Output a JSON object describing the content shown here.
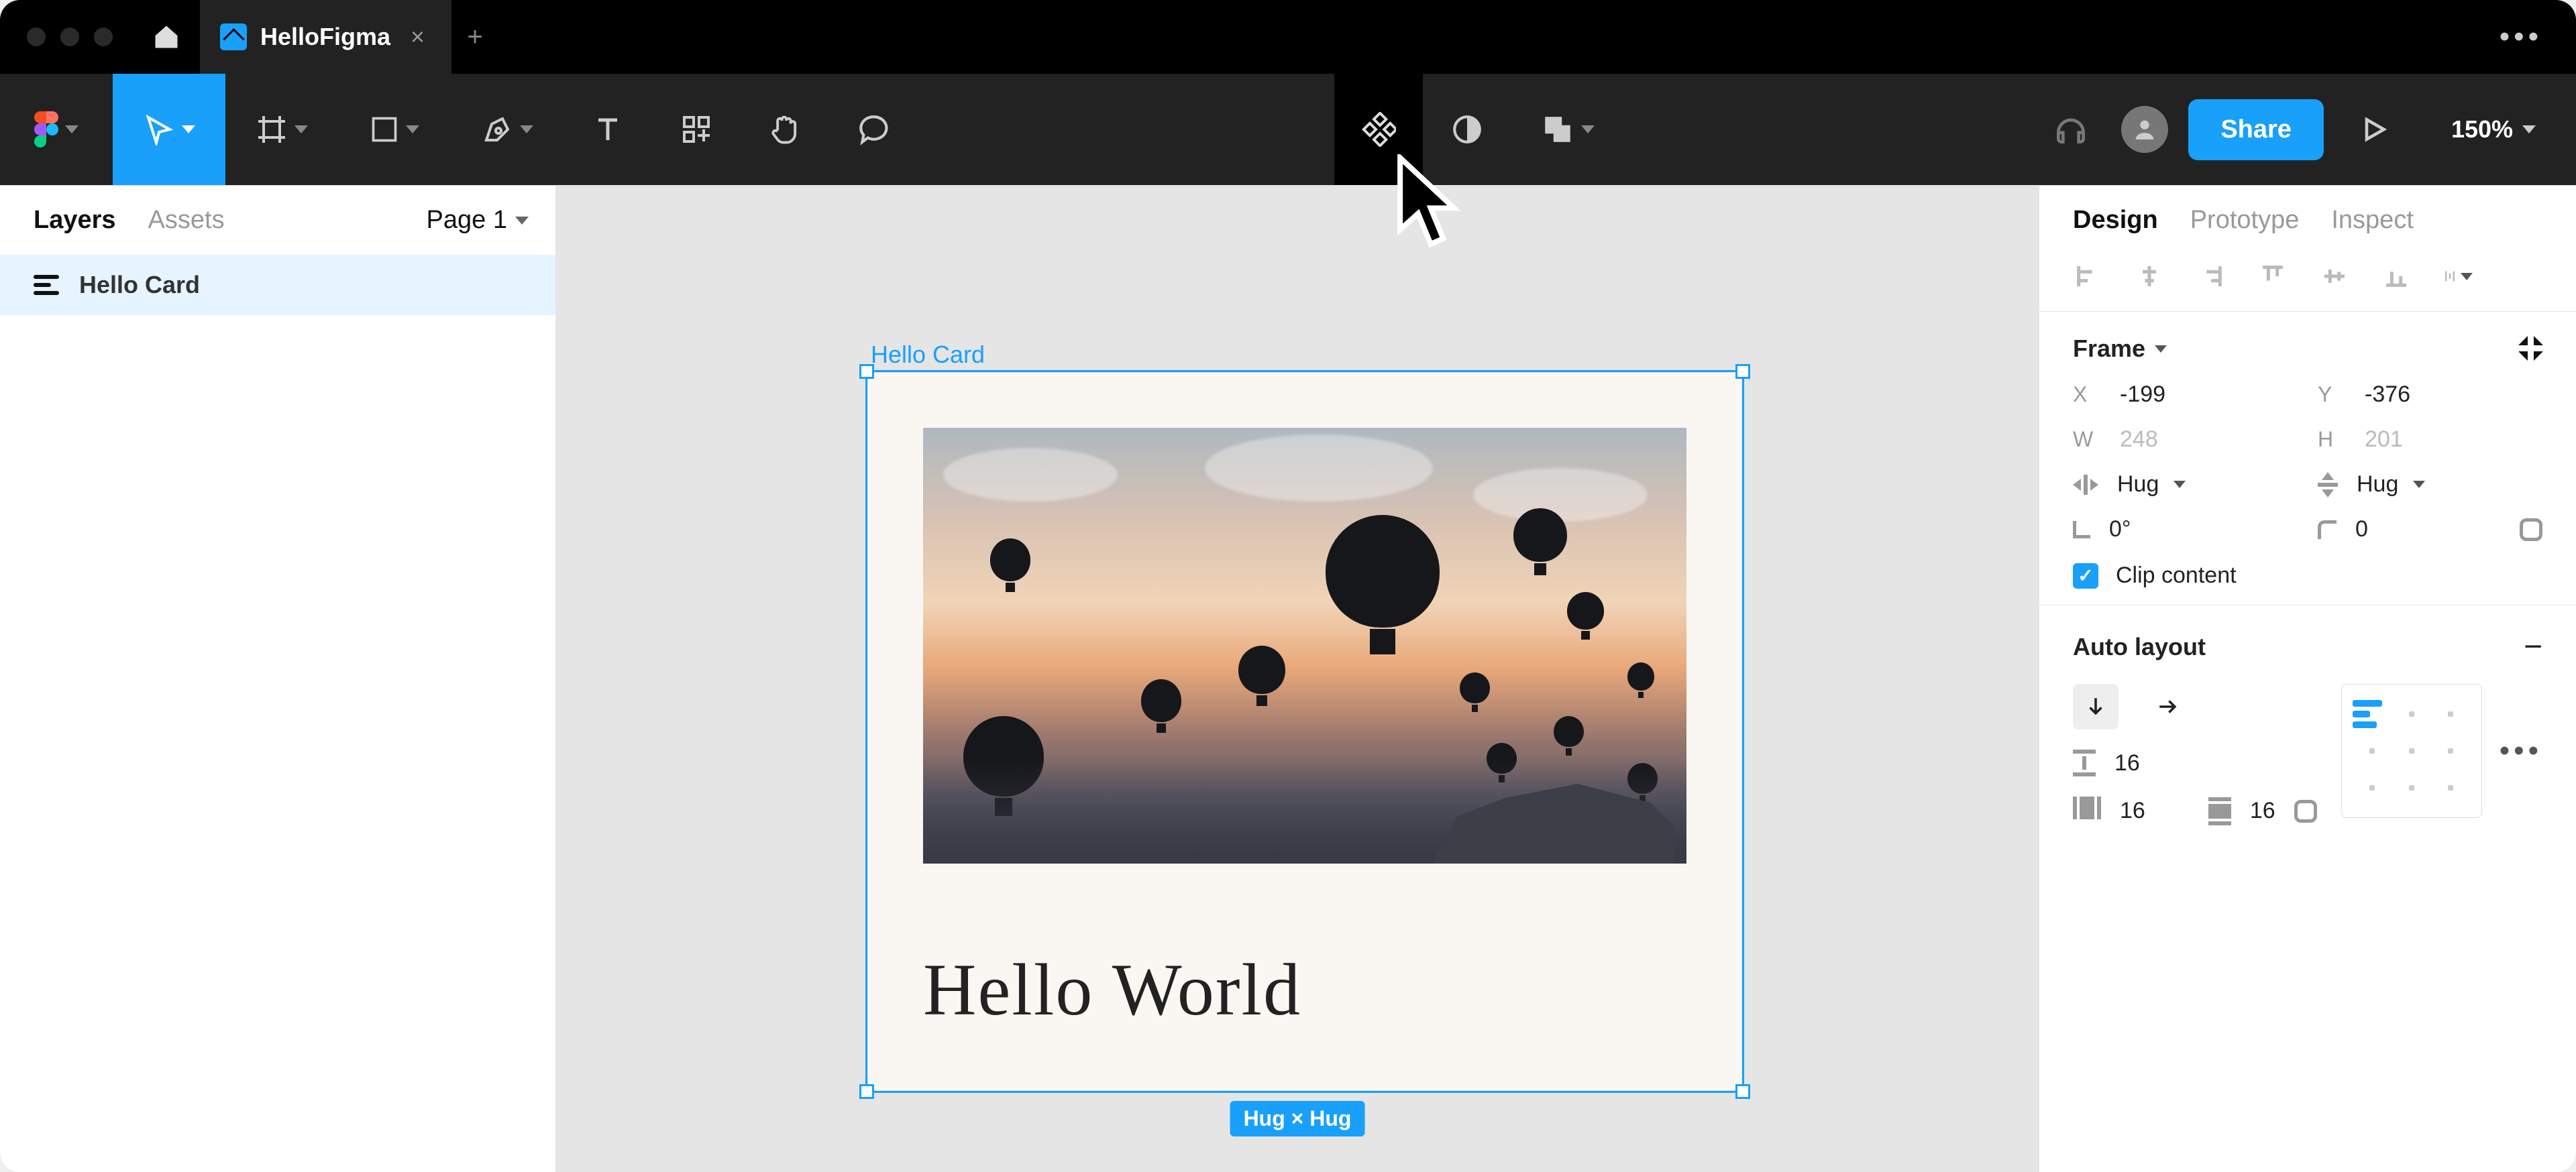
{
  "titlebar": {
    "file_tab_label": "HelloFigma"
  },
  "toolbar": {
    "share_label": "Share",
    "zoom_label": "150%"
  },
  "left_panel": {
    "tab_layers": "Layers",
    "tab_assets": "Assets",
    "page_label": "Page 1",
    "layer_name": "Hello Card"
  },
  "canvas": {
    "frame_label": "Hello Card",
    "card_title": "Hello World",
    "size_tag": "Hug × Hug"
  },
  "right_panel": {
    "tab_design": "Design",
    "tab_prototype": "Prototype",
    "tab_inspect": "Inspect",
    "frame_section": {
      "title": "Frame",
      "x_label": "X",
      "x_value": "-199",
      "y_label": "Y",
      "y_value": "-376",
      "w_label": "W",
      "w_value": "248",
      "h_label": "H",
      "h_value": "201",
      "resize_w_value": "Hug",
      "resize_h_value": "Hug",
      "rotation_value": "0°",
      "corner_value": "0",
      "clip_label": "Clip content"
    },
    "autolayout_section": {
      "title": "Auto layout",
      "gap_value": "16",
      "pad_h_value": "16",
      "pad_v_value": "16"
    }
  }
}
